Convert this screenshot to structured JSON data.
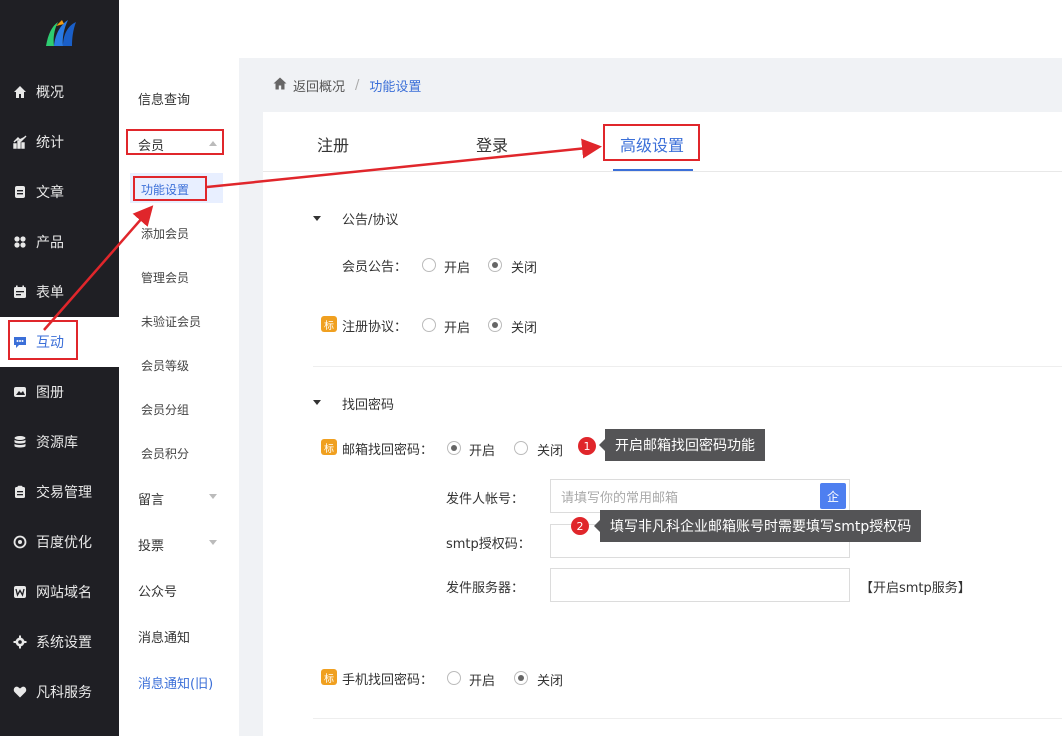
{
  "nav": {
    "items": [
      {
        "label": "概况",
        "icon": "home-icon"
      },
      {
        "label": "统计",
        "icon": "chart-icon"
      },
      {
        "label": "文章",
        "icon": "article-icon"
      },
      {
        "label": "产品",
        "icon": "product-icon"
      },
      {
        "label": "表单",
        "icon": "form-icon"
      },
      {
        "label": "互动",
        "icon": "chat-icon"
      },
      {
        "label": "图册",
        "icon": "gallery-icon"
      },
      {
        "label": "资源库",
        "icon": "database-icon"
      },
      {
        "label": "交易管理",
        "icon": "trade-icon"
      },
      {
        "label": "百度优化",
        "icon": "seo-icon"
      },
      {
        "label": "网站域名",
        "icon": "domain-icon"
      },
      {
        "label": "系统设置",
        "icon": "gear-icon"
      },
      {
        "label": "凡科服务",
        "icon": "heart-icon"
      }
    ],
    "active": "互动"
  },
  "subnav": {
    "info": "信息查询",
    "member": "会员",
    "member_children": [
      "功能设置",
      "添加会员",
      "管理会员",
      "未验证会员",
      "会员等级",
      "会员分组",
      "会员积分"
    ],
    "message": "留言",
    "vote": "投票",
    "official": "公众号",
    "notify": "消息通知",
    "notify_old": "消息通知(旧)"
  },
  "breadcrumb": {
    "back": "返回概况",
    "sep": "/",
    "current": "功能设置"
  },
  "tabs": [
    "注册",
    "登录",
    "高级设置"
  ],
  "active_tab": "高级设置",
  "sections": {
    "notice": {
      "title": "公告/协议",
      "member_notice_label": "会员公告：",
      "member_notice_on": "开启",
      "member_notice_off": "关闭",
      "agreement_label": "注册协议：",
      "agreement_on": "开启",
      "agreement_off": "关闭",
      "badge": "标"
    },
    "recover": {
      "title": "找回密码",
      "email_label": "邮箱找回密码：",
      "email_on": "开启",
      "email_off": "关闭",
      "sender_label": "发件人帐号：",
      "sender_placeholder": "请填写你的常用邮箱",
      "sender_btn": "企",
      "smtp_label": "smtp授权码：",
      "server_label": "发件服务器：",
      "smtp_link": "【开启smtp服务】",
      "phone_label": "手机找回密码：",
      "phone_on": "开启",
      "phone_off": "关闭",
      "badge": "标"
    }
  },
  "tips": [
    {
      "num": "1",
      "text": "开启邮箱找回密码功能"
    },
    {
      "num": "2",
      "text": "填写非凡科企业邮箱账号时需要填写smtp授权码"
    }
  ],
  "colors": {
    "accent": "#3b6fd8",
    "annotation": "#e0262b",
    "nav_bg": "#1f1f24"
  }
}
